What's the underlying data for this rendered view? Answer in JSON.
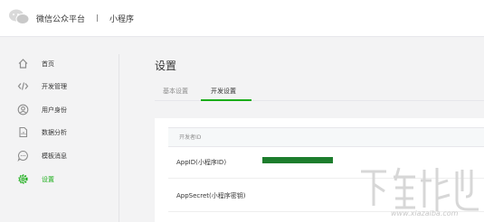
{
  "header": {
    "brand": "微信公众平台",
    "separator": "|",
    "sub_brand": "小程序"
  },
  "sidebar": {
    "items": [
      {
        "label": "首页",
        "icon": "home-icon",
        "active": false
      },
      {
        "label": "开发管理",
        "icon": "code-icon",
        "active": false
      },
      {
        "label": "用户身份",
        "icon": "user-icon",
        "active": false
      },
      {
        "label": "数据分析",
        "icon": "chart-file-icon",
        "active": false
      },
      {
        "label": "模板消息",
        "icon": "message-icon",
        "active": false
      },
      {
        "label": "设置",
        "icon": "gear-icon",
        "active": true
      }
    ]
  },
  "main": {
    "title": "设置",
    "tabs": [
      {
        "label": "基本设置",
        "active": false
      },
      {
        "label": "开发设置",
        "active": true
      }
    ],
    "section": {
      "header": "开发者ID",
      "rows": [
        {
          "label": "AppID(小程序ID)",
          "value_masked": true
        },
        {
          "label": "AppSecret(小程序密钥)"
        }
      ]
    }
  },
  "watermark": {
    "url": "www.xiazaiba.com"
  },
  "colors": {
    "accent": "#1aad19",
    "mask": "#1d7d2d",
    "text": "#353535",
    "muted": "#8d8d8d",
    "background": "#f3f3f4"
  }
}
